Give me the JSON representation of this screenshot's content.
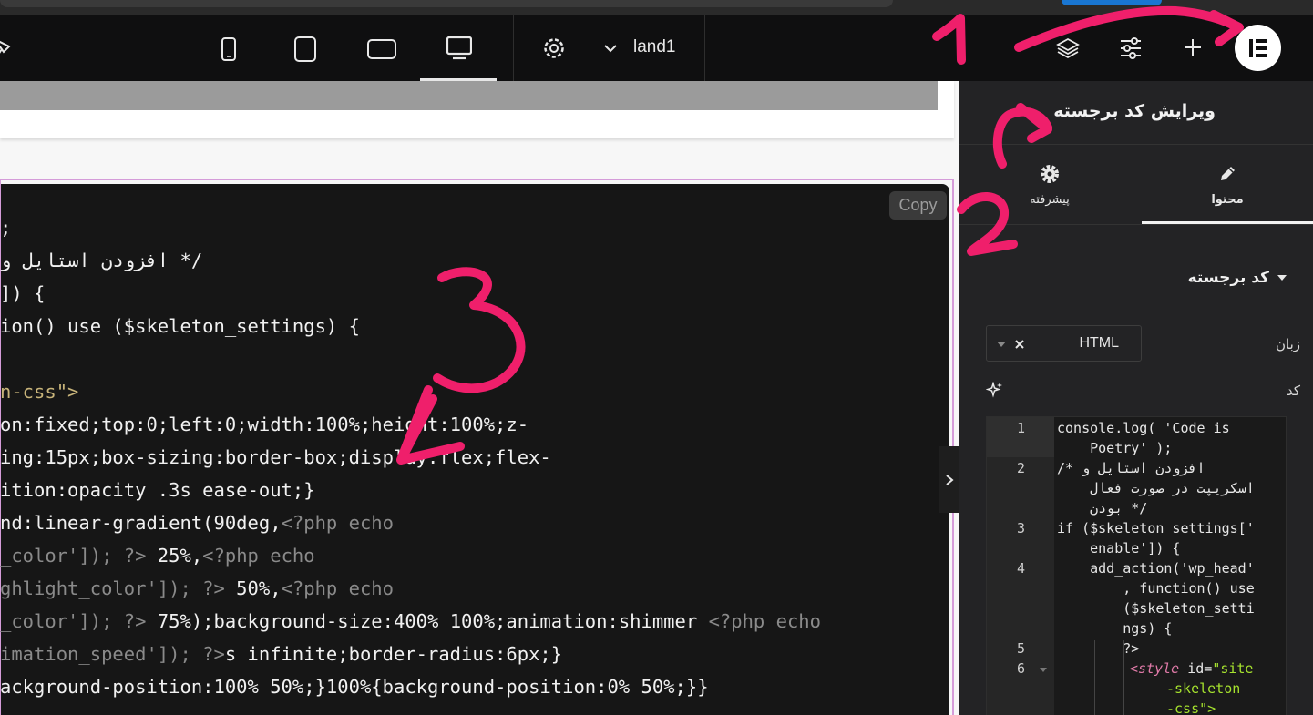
{
  "topbar": {
    "page_name": "land1",
    "icons": [
      "pin-icon",
      "mobile-icon",
      "tablet-icon",
      "laptop-icon",
      "desktop-icon",
      "settings-icon",
      "chevron-down-icon",
      "layers-icon",
      "sliders-icon",
      "plus-icon",
      "elementor-logo-icon"
    ]
  },
  "canvas": {
    "copy_label": "Copy",
    "code_lines": [
      {
        "t": ";"
      },
      {
        "t": "افزودن استایل و */"
      },
      {
        "t": "]) {"
      },
      {
        "t": "ion() use ($skeleton_settings) {"
      },
      {
        "t": ""
      },
      {
        "t": "n-css\">"
      },
      {
        "t": "on:fixed;top:0;left:0;width:100%;height:100%;z-"
      },
      {
        "t": "ing:15px;box-sizing:border-box;display:flex;flex-"
      },
      {
        "t": "ition:opacity .3s ease-out;}"
      },
      {
        "t": "nd:linear-gradient(90deg,",
        "php": "<?php echo"
      },
      {
        "p": "_color']); ?>",
        "t": " 25%,",
        "php": "<?php echo"
      },
      {
        "p": "ghlight_color']); ?>",
        "t": " 50%,",
        "php": "<?php echo"
      },
      {
        "p": "_color']); ?>",
        "t": " 75%);background-size:400% 100%;animation:shimmer ",
        "php": "<?php echo"
      },
      {
        "p": "imation_speed']); ?>",
        "t": "s infinite;border-radius:6px;}"
      },
      {
        "t": "ackground-position:100% 50%;}100%{background-position:0% 50%;}}"
      }
    ]
  },
  "panel": {
    "title": "ویرایش کد برجسته",
    "tabs": [
      {
        "label": "محتوا",
        "icon": "pencil-icon",
        "active": true
      },
      {
        "label": "پیشرفته",
        "icon": "gear-icon",
        "active": false
      }
    ],
    "section_title": "کد برجسته",
    "language_label": "زبان",
    "language_value": "HTML",
    "code_label": "کد",
    "editor": {
      "line_numbers": [
        "1",
        "2",
        "3",
        "4",
        "5",
        "6"
      ],
      "lines": [
        "console.log( 'Code is",
        "    Poetry' );",
        "/* افزودن استایل و",
        "    اسکریپت در صورت فعال",
        "    بودن */",
        "if ($skeleton_settings['",
        "    enable']) {",
        "    add_action('wp_head'",
        "        , function() use",
        "        ($skeleton_setti",
        "        ngs) {",
        "        ?>"
      ],
      "style_tag": "<style",
      "style_attr": " id=",
      "style_val_1": "\"site",
      "style_val_2": "-skeleton",
      "style_val_3": "-css\">"
    }
  },
  "annotations": {
    "numbers": [
      "1",
      "2",
      "3"
    ],
    "color": "#ef1f6b"
  }
}
